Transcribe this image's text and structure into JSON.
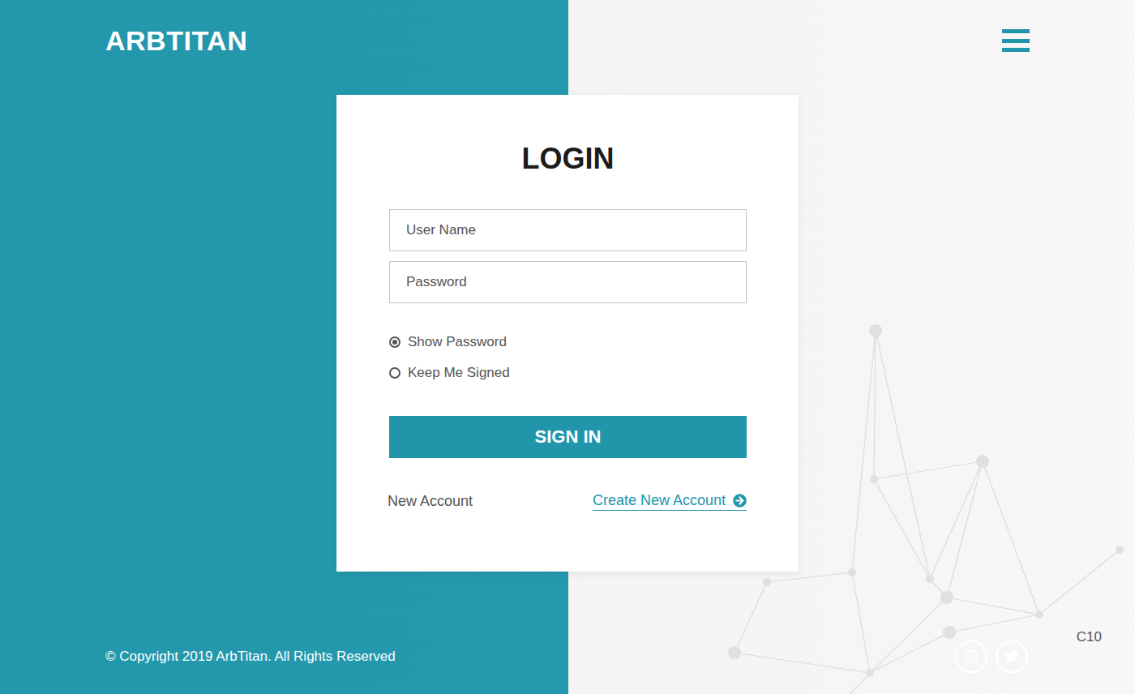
{
  "brand": {
    "name": "ARBTITAN"
  },
  "login": {
    "title": "LOGIN",
    "fields": [
      {
        "placeholder": "User Name",
        "kind": "text"
      },
      {
        "placeholder": "Password",
        "kind": "password"
      }
    ],
    "options": [
      {
        "label": "Show Password",
        "selected": true
      },
      {
        "label": "Keep Me Signed",
        "selected": false
      }
    ],
    "submit": "SIGN IN",
    "signup": {
      "label": "New Account",
      "link": "Create New Account"
    }
  },
  "footer": {
    "copyright": "© Copyright 2019 ArbTitan. All Rights Reserved",
    "corner": "C10"
  }
}
